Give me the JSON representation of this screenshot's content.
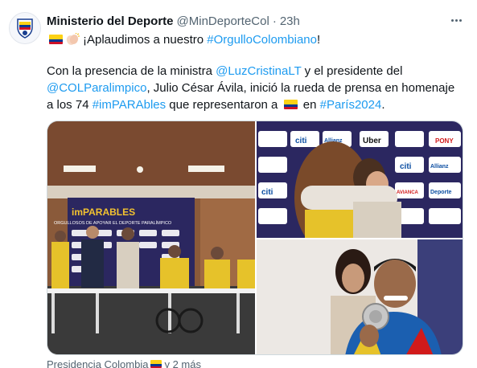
{
  "tweet": {
    "author": {
      "display_name": "Ministerio del Deporte",
      "handle": "@MinDeporteCol",
      "separator": "·",
      "time": "23h",
      "avatar_icon": "ministry-crest-icon"
    },
    "line1": {
      "flag_icon": "colombia-flag-icon",
      "clap_icon": "clapping-hands-icon",
      "text_prefix": "¡Aplaudimos a nuestro ",
      "hashtag": "#OrgulloColombiano",
      "text_suffix": "!"
    },
    "paragraph": {
      "t1": "Con la presencia de la ministra ",
      "mention1": "@LuzCristinaLT",
      "t2": " y el presidente del",
      "mention2": "@COLParalimpico",
      "t3": ", Julio César Ávila, inició la rueda de prensa en homenaje",
      "t4": "a los 74 ",
      "hashtag1": "#imPARAbles",
      "t5": " que representaron a ",
      "t6": " en ",
      "hashtag2": "#París2024",
      "t7": "."
    },
    "media": {
      "banner_title": "imPARABLES",
      "banner_subtitle": "ORGULLOSOS DE APOYAR EL DEPORTE PARALÍMPICO",
      "sponsors": [
        "citi",
        "Allianz",
        "Uber",
        "AVIANCA",
        "PONY",
        "Deporte"
      ]
    },
    "footer": {
      "text": "Presidencia Colombia",
      "more": "y 2 más"
    }
  },
  "colors": {
    "link": "#1d9bf0",
    "secondary_text": "#536471",
    "border": "#cfd9de"
  }
}
